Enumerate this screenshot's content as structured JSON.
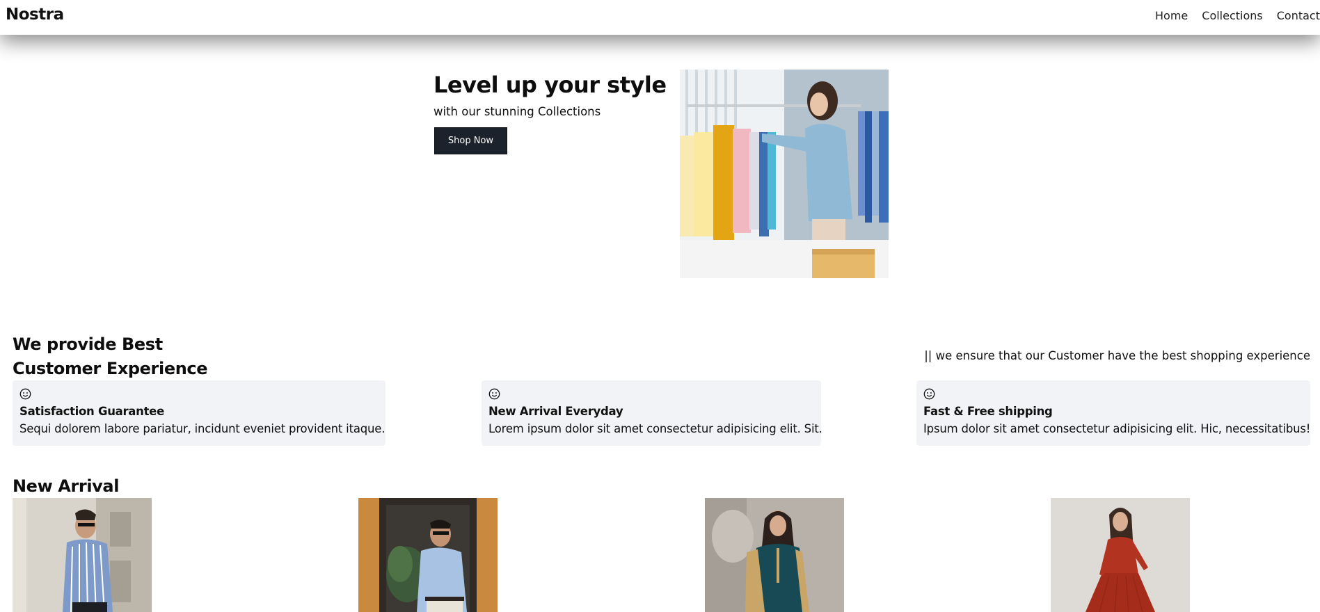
{
  "header": {
    "logo": "Nostra",
    "nav": [
      "Home",
      "Collections",
      "Contact"
    ]
  },
  "hero": {
    "title": "Level up your style",
    "subtitle": "with our stunning Collections",
    "cta_label": "Shop Now",
    "image_alt": "woman browsing clothes on a rack"
  },
  "experience": {
    "title": "We provide Best Customer Experience",
    "tagline": "|| we ensure that our Customer have the best shopping experience",
    "features": [
      {
        "icon": "smiley-icon",
        "title": "Satisfaction Guarantee",
        "text": "Sequi dolorem labore pariatur, incidunt eveniet provident itaque."
      },
      {
        "icon": "smiley-icon",
        "title": "New Arrival Everyday",
        "text": "Lorem ipsum dolor sit amet consectetur adipisicing elit. Sit."
      },
      {
        "icon": "smiley-icon",
        "title": "Fast & Free shipping",
        "text": "Ipsum dolor sit amet consectetur adipisicing elit. Hic, necessitatibus!"
      }
    ]
  },
  "new_arrival": {
    "title": "New Arrival",
    "products": [
      {
        "alt": "man in striped blue shirt"
      },
      {
        "alt": "man in light blue shirt"
      },
      {
        "alt": "woman in teal outfit"
      },
      {
        "alt": "woman in red dress"
      }
    ]
  },
  "colors": {
    "button_bg": "#1c222c",
    "card_bg": "#f2f3f6",
    "text": "#111111"
  }
}
